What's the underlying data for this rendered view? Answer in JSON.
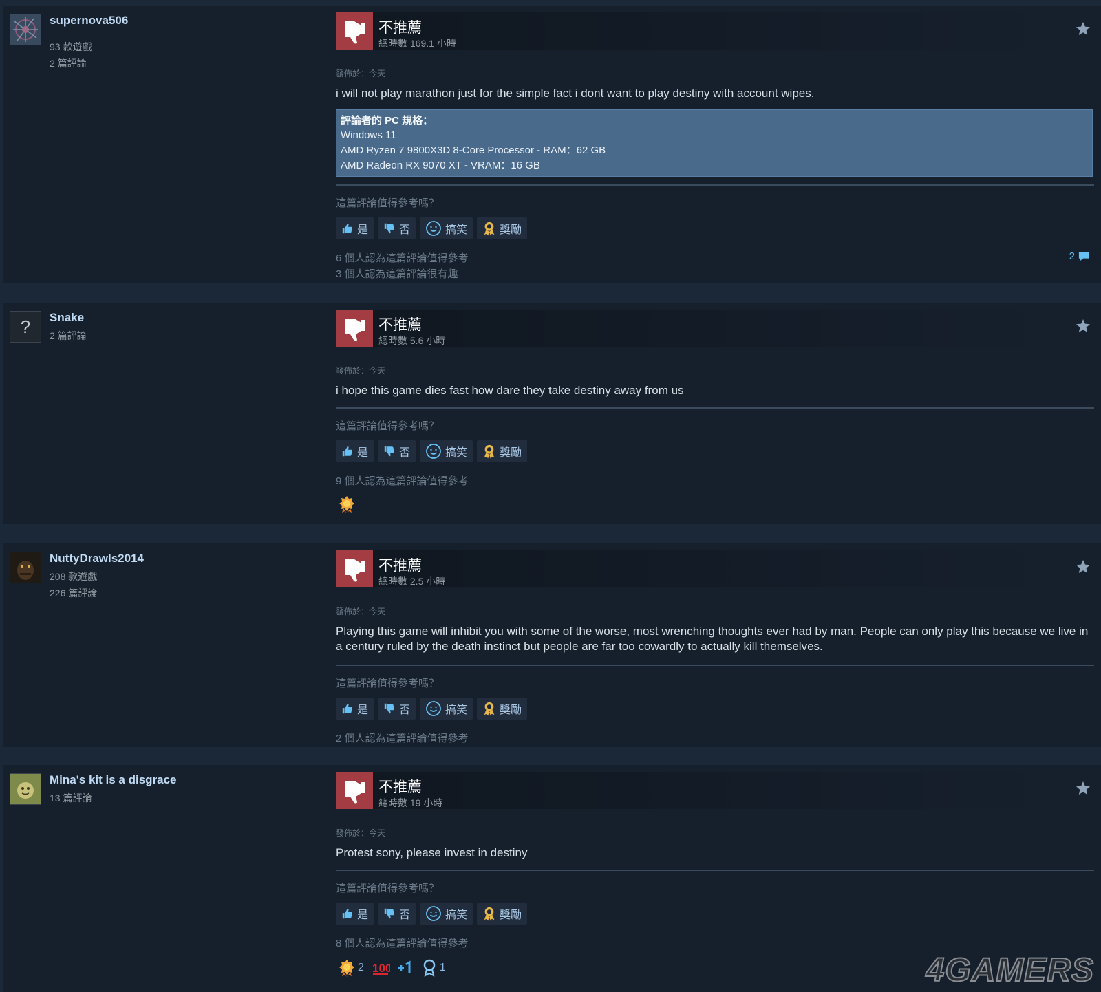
{
  "common": {
    "verdict": "不推薦",
    "posted": "發佈於：今天",
    "helpful_question": "這篇評論值得參考嗎？",
    "btn_yes": "是",
    "btn_no": "否",
    "btn_funny": "搞笑",
    "btn_award": "獎勵"
  },
  "reviews": [
    {
      "author": "supernova506",
      "games": "93 款遊戲",
      "reviews_count": "2 篇評論",
      "hours": "總時數 169.1 小時",
      "text": "i will not play marathon just for the simple fact i dont want to play destiny with account wipes.",
      "specs": {
        "title": "評論者的 PC 規格：",
        "lines": [
          "Windows 11",
          "AMD Ryzen 7 9800X3D 8-Core Processor - RAM：62 GB",
          "AMD Radeon RX 9070 XT - VRAM：16 GB"
        ]
      },
      "helpful_count": "6 個人認為這篇評論值得參考",
      "funny_count": "3 個人認為這篇評論很有趣",
      "comment_count": "2"
    },
    {
      "author": "Snake",
      "reviews_count": "2 篇評論",
      "hours": "總時數 5.6 小時",
      "text": "i hope this game dies fast how dare they take destiny away from us",
      "helpful_count": "9 個人認為這篇評論值得參考"
    },
    {
      "author": "NuttyDrawls2014",
      "games": "208 款遊戲",
      "reviews_count": "226 篇評論",
      "hours": "總時數 2.5 小時",
      "text": "Playing this game will inhibit you with some of the worse, most wrenching thoughts ever had by man. People can only play this because we live in a century ruled by the death instinct but people are far too cowardly to actually kill themselves.",
      "helpful_count": "2 個人認為這篇評論值得參考"
    },
    {
      "author": "Mina's kit is a disgrace",
      "reviews_count": "13 篇評論",
      "hours": "總時數 19 小時",
      "text": "Protest sony, please invest in destiny",
      "helpful_count": "8 個人認為這篇評論值得參考",
      "awards": [
        {
          "icon": "gold-award-icon",
          "count": "2"
        },
        {
          "icon": "100-emoji-icon",
          "count": ""
        },
        {
          "icon": "plus-one-icon",
          "count": ""
        },
        {
          "icon": "ribbon-award-icon",
          "count": "1"
        }
      ]
    }
  ],
  "watermark": "4GAMERS",
  "colors": {
    "background": "#1b2838",
    "card": "#16202d",
    "thumb_down": "#a33d43",
    "link_blue": "#66c0f4",
    "specs_bg": "#4a6a8c"
  }
}
